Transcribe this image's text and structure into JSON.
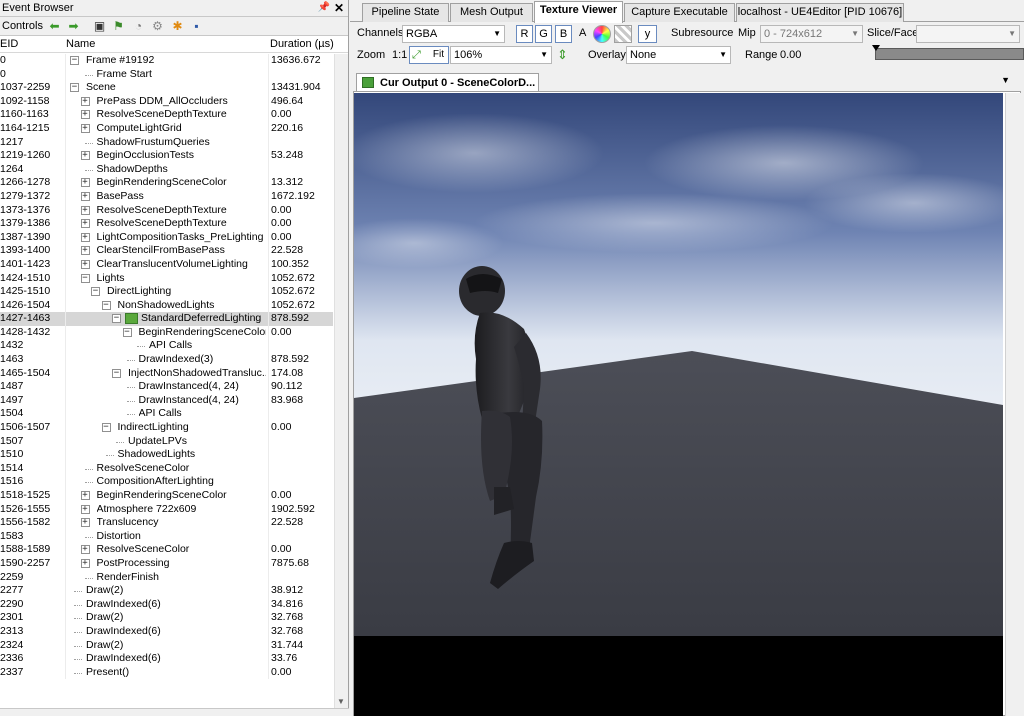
{
  "left_panel": {
    "title": "Event Browser",
    "toolbar_label": "Controls",
    "columns": {
      "eid": "EID",
      "name": "Name",
      "duration": "Duration (µs)"
    },
    "events": [
      {
        "eid": "0",
        "name": "Frame #19192",
        "duration": "13636.672",
        "depth": 0,
        "expander": "minus"
      },
      {
        "eid": "0",
        "name": "Frame Start",
        "duration": "",
        "depth": 1,
        "expander": ""
      },
      {
        "eid": "1037-2259",
        "name": "Scene",
        "duration": "13431.904",
        "depth": 0,
        "expander": "minus"
      },
      {
        "eid": "1092-1158",
        "name": "PrePass DDM_AllOccluders",
        "duration": "496.64",
        "depth": 1,
        "expander": "plus"
      },
      {
        "eid": "1160-1163",
        "name": "ResolveSceneDepthTexture",
        "duration": "0.00",
        "depth": 1,
        "expander": "plus"
      },
      {
        "eid": "1164-1215",
        "name": "ComputeLightGrid",
        "duration": "220.16",
        "depth": 1,
        "expander": "plus"
      },
      {
        "eid": "1217",
        "name": "ShadowFrustumQueries",
        "duration": "",
        "depth": 1,
        "expander": ""
      },
      {
        "eid": "1219-1260",
        "name": "BeginOcclusionTests",
        "duration": "53.248",
        "depth": 1,
        "expander": "plus"
      },
      {
        "eid": "1264",
        "name": "ShadowDepths",
        "duration": "",
        "depth": 1,
        "expander": ""
      },
      {
        "eid": "1266-1278",
        "name": "BeginRenderingSceneColor",
        "duration": "13.312",
        "depth": 1,
        "expander": "plus"
      },
      {
        "eid": "1279-1372",
        "name": "BasePass",
        "duration": "1672.192",
        "depth": 1,
        "expander": "plus"
      },
      {
        "eid": "1373-1376",
        "name": "ResolveSceneDepthTexture",
        "duration": "0.00",
        "depth": 1,
        "expander": "plus"
      },
      {
        "eid": "1379-1386",
        "name": "ResolveSceneDepthTexture",
        "duration": "0.00",
        "depth": 1,
        "expander": "plus"
      },
      {
        "eid": "1387-1390",
        "name": "LightCompositionTasks_PreLighting",
        "duration": "0.00",
        "depth": 1,
        "expander": "plus"
      },
      {
        "eid": "1393-1400",
        "name": "ClearStencilFromBasePass",
        "duration": "22.528",
        "depth": 1,
        "expander": "plus"
      },
      {
        "eid": "1401-1423",
        "name": "ClearTranslucentVolumeLighting",
        "duration": "100.352",
        "depth": 1,
        "expander": "plus"
      },
      {
        "eid": "1424-1510",
        "name": "Lights",
        "duration": "1052.672",
        "depth": 1,
        "expander": "minus"
      },
      {
        "eid": "1425-1510",
        "name": "DirectLighting",
        "duration": "1052.672",
        "depth": 2,
        "expander": "minus"
      },
      {
        "eid": "1426-1504",
        "name": "NonShadowedLights",
        "duration": "1052.672",
        "depth": 3,
        "expander": "minus"
      },
      {
        "eid": "1427-1463",
        "name": "StandardDeferredLighting",
        "duration": "878.592",
        "depth": 4,
        "expander": "minus",
        "selected": true
      },
      {
        "eid": "1428-1432",
        "name": "BeginRenderingSceneColor",
        "duration": "0.00",
        "depth": 5,
        "expander": "minus"
      },
      {
        "eid": "1432",
        "name": "API Calls",
        "duration": "",
        "depth": 6,
        "expander": ""
      },
      {
        "eid": "1463",
        "name": "DrawIndexed(3)",
        "duration": "878.592",
        "depth": 5,
        "expander": ""
      },
      {
        "eid": "1465-1504",
        "name": "InjectNonShadowedTransluc...",
        "duration": "174.08",
        "depth": 4,
        "expander": "minus"
      },
      {
        "eid": "1487",
        "name": "DrawInstanced(4, 24)",
        "duration": "90.112",
        "depth": 5,
        "expander": ""
      },
      {
        "eid": "1497",
        "name": "DrawInstanced(4, 24)",
        "duration": "83.968",
        "depth": 5,
        "expander": ""
      },
      {
        "eid": "1504",
        "name": "API Calls",
        "duration": "",
        "depth": 5,
        "expander": ""
      },
      {
        "eid": "1506-1507",
        "name": "IndirectLighting",
        "duration": "0.00",
        "depth": 3,
        "expander": "minus"
      },
      {
        "eid": "1507",
        "name": "UpdateLPVs",
        "duration": "",
        "depth": 4,
        "expander": ""
      },
      {
        "eid": "1510",
        "name": "ShadowedLights",
        "duration": "",
        "depth": 3,
        "expander": ""
      },
      {
        "eid": "1514",
        "name": "ResolveSceneColor",
        "duration": "",
        "depth": 1,
        "expander": ""
      },
      {
        "eid": "1516",
        "name": "CompositionAfterLighting",
        "duration": "",
        "depth": 1,
        "expander": ""
      },
      {
        "eid": "1518-1525",
        "name": "BeginRenderingSceneColor",
        "duration": "0.00",
        "depth": 1,
        "expander": "plus"
      },
      {
        "eid": "1526-1555",
        "name": "Atmosphere 722x609",
        "duration": "1902.592",
        "depth": 1,
        "expander": "plus"
      },
      {
        "eid": "1556-1582",
        "name": "Translucency",
        "duration": "22.528",
        "depth": 1,
        "expander": "plus"
      },
      {
        "eid": "1583",
        "name": "Distortion",
        "duration": "",
        "depth": 1,
        "expander": ""
      },
      {
        "eid": "1588-1589",
        "name": "ResolveSceneColor",
        "duration": "0.00",
        "depth": 1,
        "expander": "plus"
      },
      {
        "eid": "1590-2257",
        "name": "PostProcessing",
        "duration": "7875.68",
        "depth": 1,
        "expander": "plus"
      },
      {
        "eid": "2259",
        "name": "RenderFinish",
        "duration": "",
        "depth": 1,
        "expander": ""
      },
      {
        "eid": "2277",
        "name": "Draw(2)",
        "duration": "38.912",
        "depth": 0,
        "expander": ""
      },
      {
        "eid": "2290",
        "name": "DrawIndexed(6)",
        "duration": "34.816",
        "depth": 0,
        "expander": ""
      },
      {
        "eid": "2301",
        "name": "Draw(2)",
        "duration": "32.768",
        "depth": 0,
        "expander": ""
      },
      {
        "eid": "2313",
        "name": "DrawIndexed(6)",
        "duration": "32.768",
        "depth": 0,
        "expander": ""
      },
      {
        "eid": "2324",
        "name": "Draw(2)",
        "duration": "31.744",
        "depth": 0,
        "expander": ""
      },
      {
        "eid": "2336",
        "name": "DrawIndexed(6)",
        "duration": "33.76",
        "depth": 0,
        "expander": ""
      },
      {
        "eid": "2337",
        "name": "Present()",
        "duration": "0.00",
        "depth": 0,
        "expander": ""
      }
    ]
  },
  "tabs": [
    {
      "label": "Pipeline State",
      "active": false
    },
    {
      "label": "Mesh Output",
      "active": false
    },
    {
      "label": "Texture Viewer",
      "active": true
    },
    {
      "label": "Capture Executable",
      "active": false
    },
    {
      "label": "localhost - UE4Editor [PID 10676]",
      "active": false
    }
  ],
  "texture_toolbar": {
    "channels_label": "Channels",
    "channels_value": "RGBA",
    "r": "R",
    "g": "G",
    "b": "B",
    "a": "A",
    "y": "y",
    "subresource_label": "Subresource",
    "mip_label": "Mip",
    "mip_value": "0 - 724x612",
    "slice_label": "Slice/Face",
    "slice_value": "",
    "zoom_label": "Zoom",
    "zoom_1to1": "1:1",
    "fit_label": "Fit",
    "zoom_value": "106%",
    "overlay_label": "Overlay",
    "overlay_value": "None",
    "range_label": "Range",
    "range_value": "0.00"
  },
  "viewer": {
    "output_tab": "Cur Output 0 - SceneColorD..."
  },
  "colors": {
    "selection": "#d6d6d6",
    "sky_top": "#3a4d77",
    "floor": "#42444d"
  }
}
